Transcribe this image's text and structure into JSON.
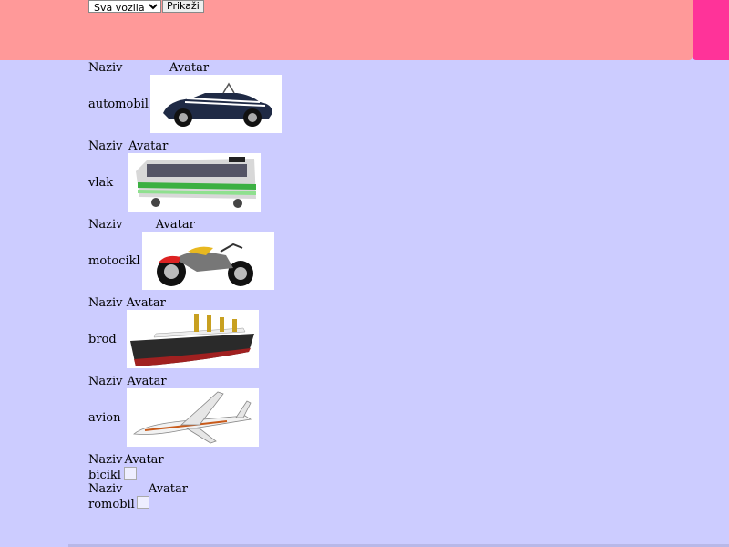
{
  "toolbar": {
    "filter_selected": "Sva vozila",
    "show_label": "Prikaži"
  },
  "table_header": {
    "name": "Naziv",
    "avatar": "Avatar"
  },
  "vehicles": [
    {
      "name": "automobil",
      "avatar": "car-image"
    },
    {
      "name": "vlak",
      "avatar": "tram-image"
    },
    {
      "name": "motocikl",
      "avatar": "motorcycle-image"
    },
    {
      "name": "brod",
      "avatar": "ship-image"
    },
    {
      "name": "avion",
      "avatar": "airplane-image"
    },
    {
      "name": "bicikl",
      "avatar": "broken-image"
    },
    {
      "name": "romobil",
      "avatar": "broken-image"
    }
  ]
}
